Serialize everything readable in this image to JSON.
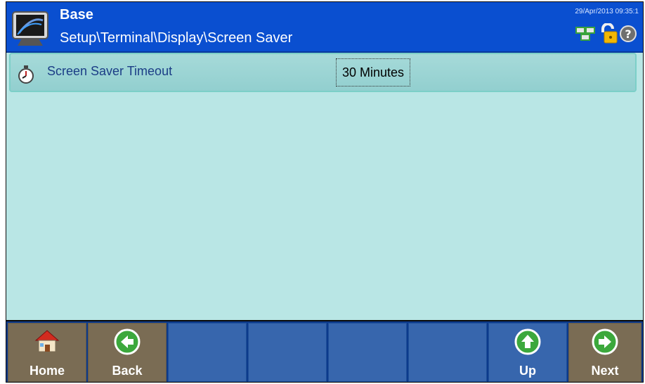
{
  "header": {
    "title": "Base",
    "path": "Setup\\Terminal\\Display\\Screen Saver",
    "datetime": "29/Apr/2013 09:35:1",
    "icons": [
      "monitor-app-icon",
      "network-icon",
      "lock-icon",
      "help-icon"
    ]
  },
  "settings": [
    {
      "label": "Screen Saver Timeout",
      "value": "30 Minutes",
      "icon": "stopwatch-icon"
    }
  ],
  "softkeys": [
    {
      "label": "Home",
      "icon": "home-icon",
      "color": "#7a6c54"
    },
    {
      "label": "Back",
      "icon": "back-arrow-icon",
      "color": "#7a6c54"
    },
    {
      "label": "",
      "icon": "",
      "color": "#3766ad"
    },
    {
      "label": "",
      "icon": "",
      "color": "#3766ad"
    },
    {
      "label": "",
      "icon": "",
      "color": "#3766ad"
    },
    {
      "label": "",
      "icon": "",
      "color": "#3766ad"
    },
    {
      "label": "Up",
      "icon": "up-arrow-icon",
      "color": "#3766ad"
    },
    {
      "label": "Next",
      "icon": "next-arrow-icon",
      "color": "#7a6c54"
    }
  ],
  "colors": {
    "header": "#0a4fd0",
    "content": "#b9e6e5",
    "row": "#9fd6d6",
    "softkey_blue": "#3766ad",
    "softkey_tan": "#7a6c54"
  }
}
